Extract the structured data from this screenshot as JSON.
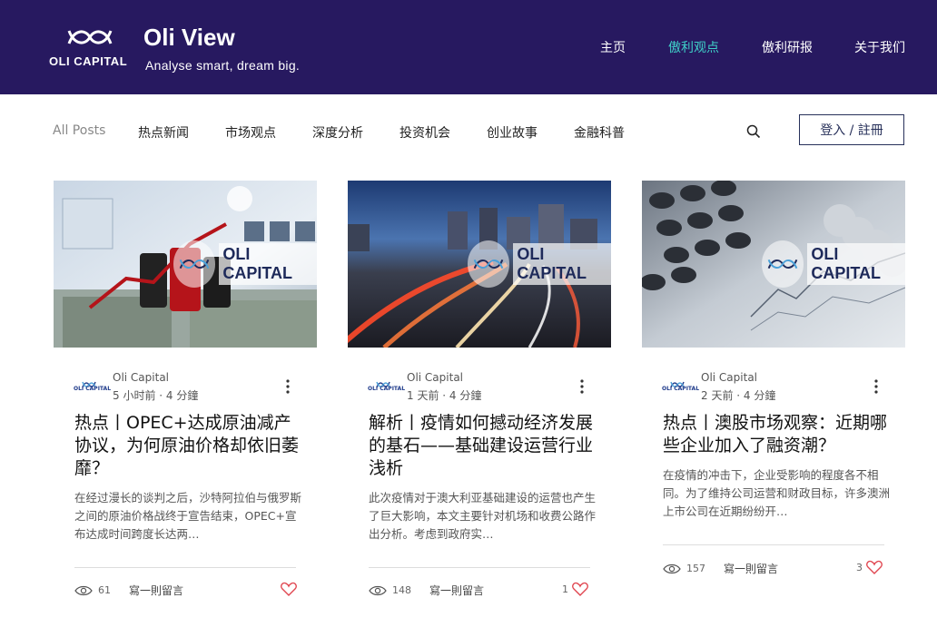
{
  "header": {
    "logo_text": "OLI CAPITAL",
    "title": "Oli View",
    "tagline": "Analyse smart, dream big.",
    "nav": [
      "主页",
      "傲利观点",
      "傲利研报",
      "关于我们"
    ],
    "active_nav": 1,
    "bg_color": "#271960",
    "accent_color": "#3fd0c8"
  },
  "categories": [
    "All Posts",
    "热点新闻",
    "市场观点",
    "深度分析",
    "投资机会",
    "创业故事",
    "金融科普"
  ],
  "login_label": "登入 / 註冊",
  "watermark_text": "OLI CAPITAL",
  "author_logo_text": "OLI CAPITAL",
  "posts": [
    {
      "author": "Oli Capital",
      "time": "5 小时前",
      "read": "4 分鐘",
      "title": "热点丨OPEC+达成原油减产协议，为何原油价格却依旧萎靡？",
      "excerpt": "在经过漫长的谈判之后，沙特阿拉伯与俄罗斯之间的原油价格战终于宣告结束，OPEC+宣布达成时间跨度长达两…",
      "views": "61",
      "comment_label": "寫一則留言",
      "likes": ""
    },
    {
      "author": "Oli Capital",
      "time": "1 天前",
      "read": "4 分鐘",
      "title": "解析丨疫情如何撼动经济发展的基石——基础建设运营行业浅析",
      "excerpt": "此次疫情对于澳大利亚基础建设的运营也产生了巨大影响，本文主要针对机场和收费公路作出分析。考虑到政府实…",
      "views": "148",
      "comment_label": "寫一則留言",
      "likes": "1"
    },
    {
      "author": "Oli Capital",
      "time": "2 天前",
      "read": "4 分鐘",
      "title": "热点丨澳股市场观察：近期哪些企业加入了融资潮？",
      "excerpt": "在疫情的冲击下，企业受影响的程度各不相同。为了维持公司运营和财政目标，许多澳洲上市公司在近期纷纷开…",
      "views": "157",
      "comment_label": "寫一則留言",
      "likes": "3"
    }
  ]
}
